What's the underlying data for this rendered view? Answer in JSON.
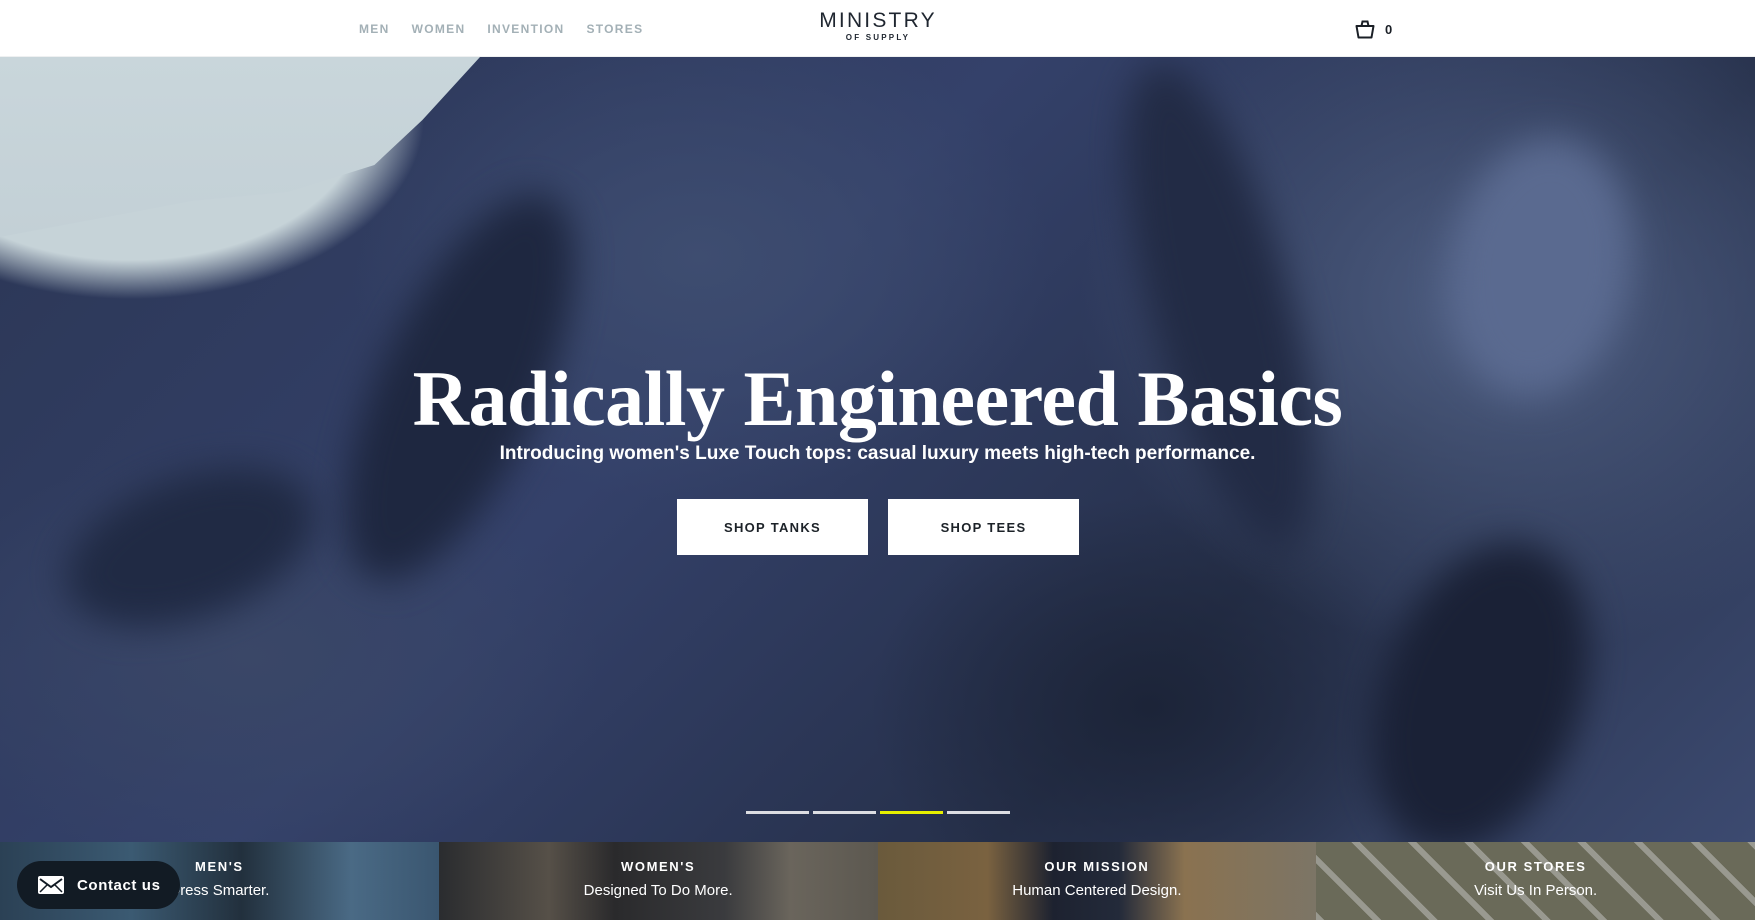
{
  "header": {
    "nav": [
      {
        "label": "MEN"
      },
      {
        "label": "WOMEN"
      },
      {
        "label": "INVENTION"
      },
      {
        "label": "STORES"
      }
    ],
    "logo": {
      "line1": "MINISTRY",
      "line2": "OF SUPPLY"
    },
    "cart": {
      "icon": "shopping-bag-icon",
      "count": "0"
    }
  },
  "hero": {
    "title": "Radically Engineered Basics",
    "subtitle": "Introducing women's Luxe Touch tops: casual luxury meets high-tech performance.",
    "buttons": [
      {
        "label": "SHOP TANKS"
      },
      {
        "label": "SHOP TEES"
      }
    ],
    "carousel": {
      "slide_count": 4,
      "active_index": 2,
      "active_color": "#e6ef00",
      "inactive_color": "#dcdde2"
    }
  },
  "tiles": [
    {
      "title": "MEN'S",
      "subtitle": "Dress Smarter."
    },
    {
      "title": "WOMEN'S",
      "subtitle": "Designed To Do More."
    },
    {
      "title": "OUR MISSION",
      "subtitle": "Human Centered Design."
    },
    {
      "title": "OUR STORES",
      "subtitle": "Visit Us In Person."
    }
  ],
  "contact": {
    "icon": "envelope-icon",
    "label": "Contact us"
  }
}
